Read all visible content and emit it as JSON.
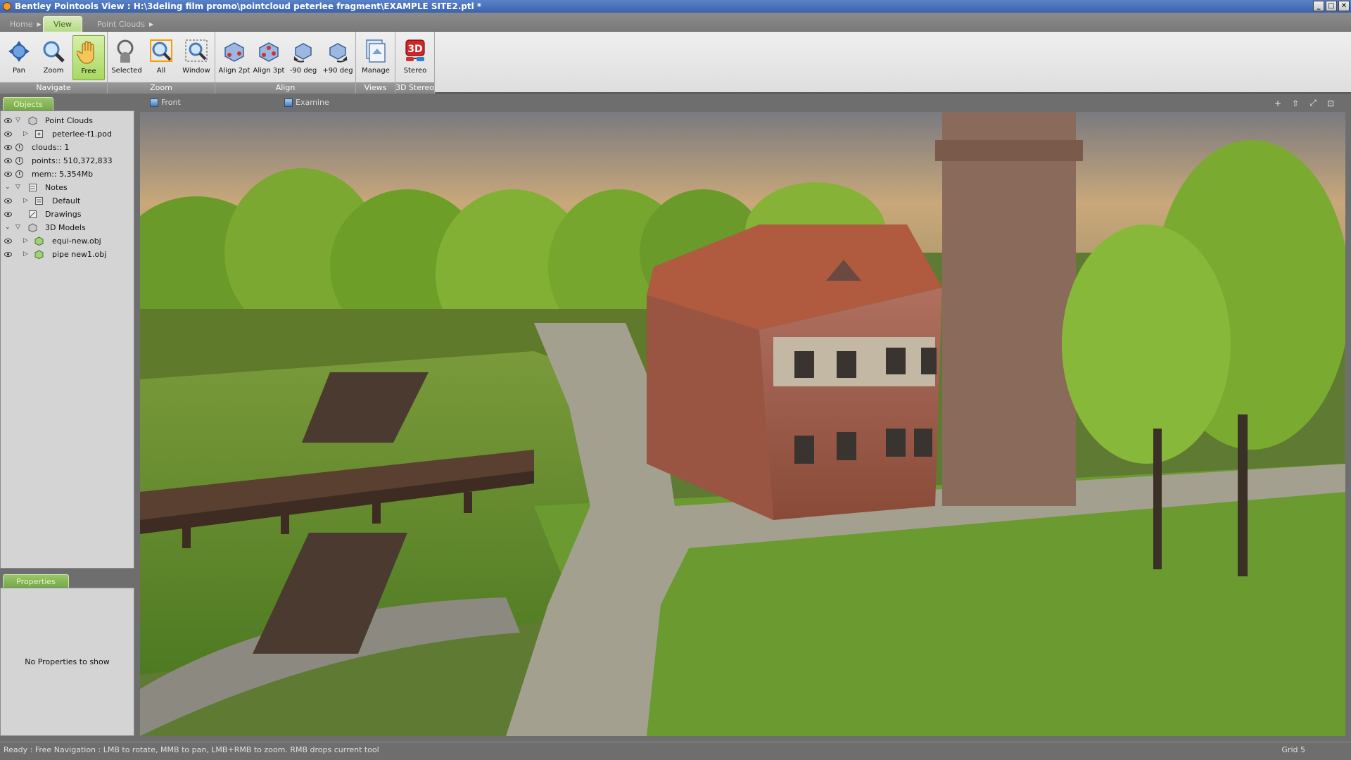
{
  "window": {
    "title": "Bentley Pointools View :  H:\\3deling film promo\\pointcloud peterlee fragment\\EXAMPLE SITE2.ptl *",
    "controls": [
      "_",
      "□",
      "✕"
    ]
  },
  "ribbon_tabs": [
    {
      "label": "Home"
    },
    {
      "label": "View"
    },
    {
      "label": "Point Clouds"
    }
  ],
  "ribbon": {
    "groups": [
      {
        "label": "Navigate",
        "buttons": [
          {
            "label": "Pan",
            "icon": "pan-icon"
          },
          {
            "label": "Zoom",
            "icon": "zoom-icon"
          },
          {
            "label": "Free",
            "icon": "hand-icon",
            "active": true
          }
        ]
      },
      {
        "label": "Zoom",
        "buttons": [
          {
            "label": "Selected",
            "icon": "zoom-selected-icon"
          },
          {
            "label": "All",
            "icon": "zoom-all-icon"
          },
          {
            "label": "Window",
            "icon": "zoom-window-icon"
          }
        ]
      },
      {
        "label": "Align",
        "buttons": [
          {
            "label": "Align 2pt",
            "icon": "align-2pt-icon"
          },
          {
            "label": "Align 3pt",
            "icon": "align-3pt-icon"
          },
          {
            "label": "-90 deg",
            "icon": "rotate-minus-90-icon"
          },
          {
            "label": "+90 deg",
            "icon": "rotate-plus-90-icon"
          }
        ]
      },
      {
        "label": "Views",
        "buttons": [
          {
            "label": "Manage",
            "icon": "manage-views-icon"
          }
        ]
      },
      {
        "label": "3D Stereo",
        "buttons": [
          {
            "label": "Stereo",
            "icon": "stereo-3d-icon"
          }
        ]
      }
    ]
  },
  "objects_panel": {
    "tab_label": "Objects",
    "tree": [
      {
        "label": "Point Clouds",
        "expanded": true
      },
      {
        "label": "peterlee-f1.pod"
      },
      {
        "label": "clouds:: 1"
      },
      {
        "label": "points:: 510,372,833"
      },
      {
        "label": "mem:: 5,354Mb"
      },
      {
        "label": "Notes",
        "expanded": true
      },
      {
        "label": "Default"
      },
      {
        "label": "Drawings"
      },
      {
        "label": "3D Models",
        "expanded": true
      },
      {
        "label": "equi-new.obj"
      },
      {
        "label": "pipe new1.obj"
      }
    ]
  },
  "properties_panel": {
    "tab_label": "Properties",
    "empty_text": "No Properties to show"
  },
  "viewport": {
    "tabs": [
      {
        "label": "Front"
      },
      {
        "label": "Examine"
      }
    ],
    "controls": [
      "+",
      "⇧",
      "⤢",
      "⊡"
    ]
  },
  "statusbar": {
    "text": "Ready : Free Navigation : LMB to rotate, MMB to pan, LMB+RMB to zoom. RMB drops current tool",
    "grid": "Grid 5"
  }
}
